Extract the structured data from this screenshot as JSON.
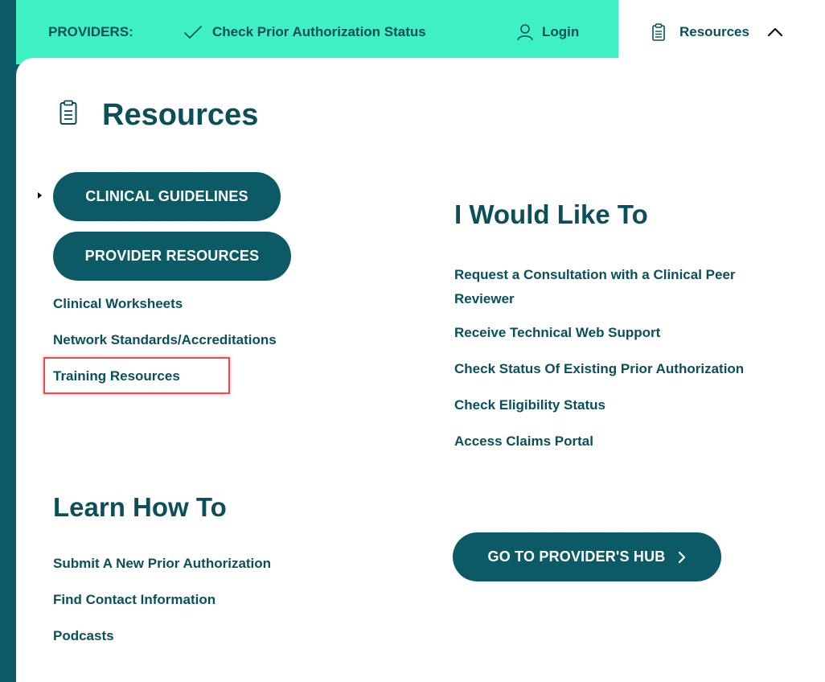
{
  "topbar": {
    "providers_label": "PROVIDERS:",
    "check_status_label": "Check Prior Authorization Status",
    "login_label": "Login",
    "resources_label": "Resources",
    "bg_color": "#3ff0c2",
    "icons": {
      "check": "check-icon",
      "login": "user-icon",
      "resources": "clipboard-icon",
      "expand": "chevron-up-icon"
    }
  },
  "panel": {
    "title": "Resources",
    "buttons": [
      {
        "label": "CLINICAL GUIDELINES"
      },
      {
        "label": "PROVIDER RESOURCES"
      }
    ],
    "resource_links": [
      {
        "label": "Clinical Worksheets"
      },
      {
        "label": "Network Standards/Accreditations"
      },
      {
        "label": "Training Resources"
      }
    ],
    "would_like": {
      "heading": "I Would Like To",
      "links": [
        {
          "label": "Request a Consultation with a Clinical Peer Reviewer"
        },
        {
          "label": "Receive Technical Web Support"
        },
        {
          "label": "Check Status Of Existing Prior Authorization"
        },
        {
          "label": "Check Eligibility Status"
        },
        {
          "label": "Access Claims Portal"
        }
      ]
    },
    "learn": {
      "heading": "Learn How To",
      "links": [
        {
          "label": "Submit A New Prior Authorization"
        },
        {
          "label": "Find Contact Information"
        },
        {
          "label": "Podcasts"
        }
      ]
    },
    "hub_button": {
      "label": "GO TO PROVIDER'S HUB"
    }
  },
  "colors": {
    "brand_dark": "#0b5a66",
    "brand_accent": "#3ff0c2",
    "highlight": "#e05050"
  }
}
